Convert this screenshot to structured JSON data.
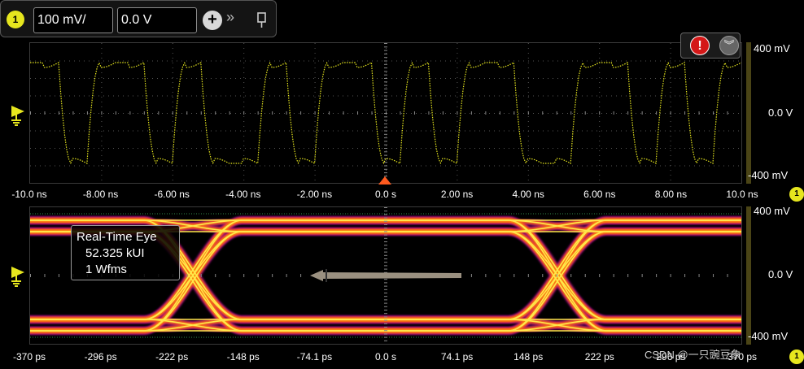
{
  "toolbar": {
    "channel": "1",
    "scale_value": "100 mV/",
    "offset_value": "0.0 V",
    "add_symbol": "+",
    "expand_symbol": "»"
  },
  "alert": {
    "symbol": "!",
    "collapse_symbol": "︾"
  },
  "top_plot": {
    "time_ticks": [
      "-10.0 ns",
      "-8.00 ns",
      "-6.00 ns",
      "-4.00 ns",
      "-2.00 ns",
      "0.0 s",
      "2.00 ns",
      "4.00 ns",
      "6.00 ns",
      "8.00 ns",
      "10.0 ns"
    ],
    "volt_top": "400 mV",
    "volt_mid": "0.0 V",
    "volt_bottom": "-400 mV",
    "channel_badge": "1",
    "trace_color": "#e6e61e"
  },
  "eye_plot": {
    "time_ticks": [
      "-370 ps",
      "-296 ps",
      "-222 ps",
      "-148 ps",
      "-74.1 ps",
      "0.0 s",
      "74.1 ps",
      "148 ps",
      "222 ps",
      "296 ps",
      "370 ps"
    ],
    "volt_top": "400 mV",
    "volt_mid": "0.0 V",
    "volt_bottom": "-400 mV",
    "channel_badge": "1",
    "info_title": "Real-Time Eye",
    "info_ui": "52.325 kUI",
    "info_wfms": "1 Wfms"
  },
  "watermark": "CSDN @一只豌豆象"
}
